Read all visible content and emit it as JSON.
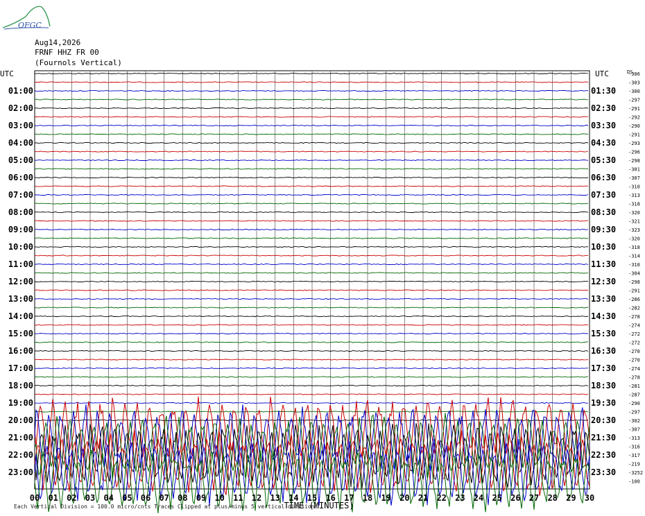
{
  "logo": {
    "text": "OFGC"
  },
  "header": {
    "date": "Aug14,2026",
    "station": "FRNF HHZ FR 00",
    "location": "(Fournols Vertical)"
  },
  "chart_data": {
    "type": "line",
    "title": "FRNF HHZ FR 00 (Fournols Vertical)",
    "left_axis_label": "UTC",
    "right_axis_label": "UTC",
    "ds_label": "DS",
    "xlabel": "TIME (MINUTES)",
    "x_ticks": [
      "00",
      "01",
      "02",
      "03",
      "04",
      "05",
      "06",
      "07",
      "08",
      "09",
      "10",
      "11",
      "12",
      "13",
      "14",
      "15",
      "16",
      "17",
      "18",
      "19",
      "20",
      "21",
      "22",
      "23",
      "24",
      "25",
      "26",
      "27",
      "28",
      "29",
      "30"
    ],
    "left_row_labels": [
      "01:00",
      "02:00",
      "03:00",
      "04:00",
      "05:00",
      "06:00",
      "07:00",
      "08:00",
      "09:00",
      "10:00",
      "11:00",
      "12:00",
      "13:00",
      "14:00",
      "15:00",
      "16:00",
      "17:00",
      "18:00",
      "19:00",
      "20:00",
      "21:00",
      "22:00",
      "23:00"
    ],
    "right_row_labels": [
      "01:30",
      "02:30",
      "03:30",
      "04:30",
      "05:30",
      "06:30",
      "07:30",
      "08:30",
      "09:30",
      "10:30",
      "11:30",
      "12:30",
      "13:30",
      "14:30",
      "15:30",
      "16:30",
      "17:30",
      "18:30",
      "19:30",
      "20:30",
      "21:30",
      "22:30",
      "23:30"
    ],
    "trace_colors": [
      "#000000",
      "#cc0000",
      "#0000cc",
      "#006600"
    ],
    "ds_values": [
      "-306",
      "-303",
      "-300",
      "-297",
      "-291",
      "-292",
      "-290",
      "-291",
      "-293",
      "-296",
      "-298",
      "-301",
      "-307",
      "-310",
      "-313",
      "-318",
      "-320",
      "-321",
      "-323",
      "-320",
      "-318",
      "-314",
      "-310",
      "-304",
      "-298",
      "-291",
      "-286",
      "-282",
      "-278",
      "-274",
      "-272",
      "-272",
      "-270",
      "-270",
      "-274",
      "-278",
      "-281",
      "-287",
      "-290",
      "-297",
      "-302",
      "-307",
      "-313",
      "-316",
      "-317",
      "-219",
      "-3252",
      "-100"
    ],
    "active_from_row": 41,
    "footer_text": "Each Vertical Division = 100.0 micro/cnts    Traces Clipped at plus/minus 5 vertical divisions",
    "grid": true
  }
}
